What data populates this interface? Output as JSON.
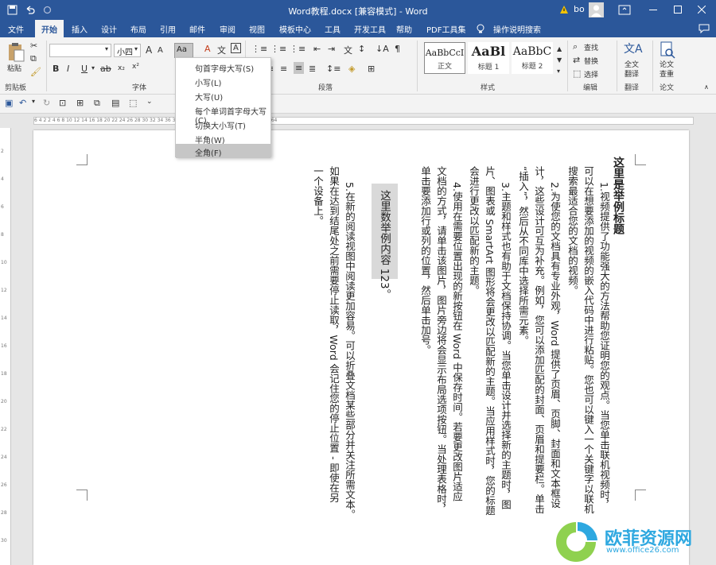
{
  "window": {
    "title": "Word教程.docx [兼容模式] - Word",
    "user": "bo",
    "warning_icon": "warning-icon"
  },
  "tabs": [
    "文件",
    "开始",
    "插入",
    "设计",
    "布局",
    "引用",
    "邮件",
    "审阅",
    "视图",
    "模板中心",
    "工具",
    "开发工具",
    "帮助",
    "PDF工具集"
  ],
  "tell_me": "操作说明搜索",
  "ribbon": {
    "clipboard": {
      "paste": "粘贴",
      "group": "剪贴板"
    },
    "font": {
      "name": "",
      "size": "小四",
      "case_button": "Aa",
      "group": "字体",
      "bold": "B",
      "italic": "I",
      "underline": "U"
    },
    "paragraph": {
      "group": "段落"
    },
    "styles": {
      "group": "样式",
      "items": [
        {
          "sample": "AaBbCcI",
          "name": "正文"
        },
        {
          "sample": "AaBl",
          "name": "标题 1"
        },
        {
          "sample": "AaBbC",
          "name": "标题 2"
        }
      ]
    },
    "editing": {
      "group": "编辑",
      "find": "查找",
      "replace": "替换",
      "select": "选择"
    },
    "translate": {
      "label1": "全文",
      "label2": "翻译",
      "group": "翻译"
    },
    "paper": {
      "label1": "论文",
      "label2": "查重",
      "group": "论文"
    }
  },
  "change_case_menu": {
    "items": [
      "句首字母大写(S)",
      "小写(L)",
      "大写(U)",
      "每个单词首字母大写(C)",
      "切换大小写(T)",
      "半角(W)",
      "全角(F)"
    ],
    "selected_index": 6
  },
  "ruler": {
    "marks": "6  4  2     2  4  6  8  10  12  14  16  18  20  22  24  26  28  30  32  34  36  38  40  42  44  46  48  50  52  54  56  58  60  62  64"
  },
  "vruler": {
    "marks": [
      "2",
      "4",
      "6",
      "8",
      "10",
      "12",
      "14",
      "16",
      "18",
      "20",
      "22",
      "24",
      "26",
      "28",
      "30"
    ]
  },
  "document": {
    "heading": "这里是举例标题",
    "columns": [
      "1.视频提供了功能强大的方法帮助您证明您的观点。当您单击联机视频时，",
      "可以在想要添加的视频的嵌入代码中进行粘贴。您也可以键入一个关键字以联机",
      "搜索最适合您的文档的视频。",
      "2.为使您的文档具有专业外观，Word 提供了页眉、页脚、封面和文本框设",
      "计，这些设计可互为补充。例如，您可以添加匹配的封面、页眉和提要栏。单击",
      "“插入”，然后从不同库中选择所需元素。",
      "3.主题和样式也有助于文档保持协调。当您单击设计并选择新的主题时，图",
      "片、图表或 SmartArt 图形将会更改以匹配新的主题。当应用样式时，您的标题",
      "会进行更改以匹配新的主题。",
      "4.使用在需要位置出现的新按钮在 Word 中保存时间。若要更改图片适应",
      "文档的方式，请单击该图片，图片旁边将会显示布局选项按钮。当处理表格时，",
      "单击要添加行或列的位置，然后单击加号。",
      "5.在新的阅读视图中阅读更加容易。可以折叠文档某些部分并关注所需文本。",
      "如果在达到结尾处之前需要停止读取，Word 会记住您的停止位置 - 即使在另",
      "一个设备上。"
    ],
    "highlight": "这里数举例内容 123。"
  },
  "watermark": {
    "text": "欧菲资源网",
    "url": "www.office26.com"
  }
}
